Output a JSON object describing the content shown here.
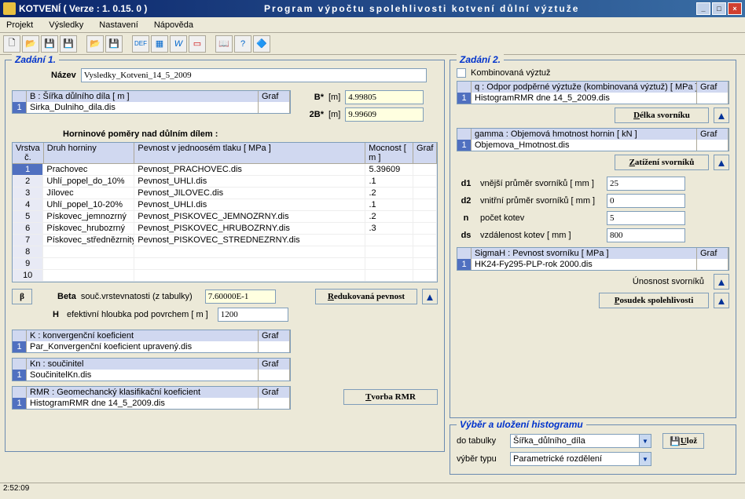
{
  "title_left": "KOTVENÍ ( Verze : 1. 0.15. 0 )",
  "title_center": "Program výpočtu spolehlivosti kotvení důlní výztuže",
  "menu": [
    "Projekt",
    "Výsledky",
    "Nastavení",
    "Nápověda"
  ],
  "z1_legend": "Zadání 1.",
  "z2_legend": "Zadání 2.",
  "hist_legend": "Výběr a uložení histogramu",
  "nazev_label": "Název",
  "nazev_value": "Vysledky_Kotveni_14_5_2009",
  "b_header": "B : Šířka důlního díla   [ m ]",
  "graf": "Graf",
  "b_file": "Sirka_Dulniho_dila.dis",
  "bstar_label": "B*",
  "b2star_label": "2B*",
  "m_unit": "[m]",
  "bstar_val": "4.99805",
  "b2star_val": "9.99609",
  "horn_title": "Horninové poměry nad důlním dílem :",
  "grid": {
    "h1": "Vrstva č.",
    "h2": "Druh horniny",
    "h3": "Pevnost v jednoosém tlaku   [ MPa ]",
    "h4": "Mocnost [ m ]",
    "h5": "Graf",
    "rows": [
      {
        "n": "1",
        "druh": "Prachovec",
        "pev": "Pevnost_PRACHOVEC.dis",
        "moc": "5.39609"
      },
      {
        "n": "2",
        "druh": "Uhlí_popel_do_10%",
        "pev": "Pevnost_UHLI.dis",
        "moc": ".1"
      },
      {
        "n": "3",
        "druh": "Jílovec",
        "pev": "Pevnost_JILOVEC.dis",
        "moc": ".2"
      },
      {
        "n": "4",
        "druh": "Uhlí_popel_10-20%",
        "pev": "Pevnost_UHLI.dis",
        "moc": ".1"
      },
      {
        "n": "5",
        "druh": "Pískovec_jemnozrný",
        "pev": "Pevnost_PISKOVEC_JEMNOZRNY.dis",
        "moc": ".2"
      },
      {
        "n": "6",
        "druh": "Pískovec_hrubozrný",
        "pev": "Pevnost_PISKOVEC_HRUBOZRNY.dis",
        "moc": ".3"
      },
      {
        "n": "7",
        "druh": "Pískovec_střednězrnitý",
        "pev": "Pevnost_PISKOVEC_STREDNEZRNY.dis",
        "moc": ""
      },
      {
        "n": "8",
        "druh": "",
        "pev": "",
        "moc": ""
      },
      {
        "n": "9",
        "druh": "",
        "pev": "",
        "moc": ""
      },
      {
        "n": "10",
        "druh": "",
        "pev": "",
        "moc": ""
      }
    ]
  },
  "beta_btn": "β",
  "beta_label": "Beta",
  "beta_desc": "souč.vrstevnatosti (z tabulky)",
  "beta_val": "7.60000E-1",
  "redpev_label": "Redukovaná pevnost",
  "h_label": "H",
  "h_desc": "efektivní hloubka pod povrchem  [ m ]",
  "h_val": "1200",
  "k_header": "K : konvergenční koeficient",
  "k_file": "Par_Konvergenční koeficient upravený.dis",
  "kn_header": "Kn : součinitel",
  "kn_file": "SoučinitelKn.dis",
  "rmr_header": "RMR : Geomechancký klasifikační koeficient",
  "rmr_file": "HistogramRMR dne 14_5_2009.dis",
  "tvorba_rmr": "Tvorba  RMR",
  "komb_label": "Kombinovaná výztuž",
  "q_header": "q : Odpor podpěrné výztuže (kombinovaná výztuž)   [ MPa ]",
  "q_file": "HistogramRMR dne 14_5_2009.dis",
  "delka_sv": "Délka svorníku",
  "gamma_header": "gamma : Objemová hmotnost hornin   [ kN ]",
  "gamma_file": "Objemova_Hmotnost.dis",
  "zat_sv": "Zatížení svorníků",
  "params": {
    "d1": {
      "l": "d1",
      "d": "vnější průměr svorníků [ mm ]",
      "v": "25"
    },
    "d2": {
      "l": "d2",
      "d": "vnitřní průměr svorníků [ mm ]",
      "v": "0"
    },
    "n": {
      "l": "n",
      "d": "počet kotev",
      "v": "5"
    },
    "ds": {
      "l": "ds",
      "d": "vzdálenost kotev [ mm ]",
      "v": "800"
    }
  },
  "sigmah_header": "SigmaH : Pevnost svorníku   [ MPa ]",
  "sigmah_file": "HK24-Fy295-PLP-rok 2000.dis",
  "unos_sv": "Únosnost svorníků",
  "posudek": "Posudek spolehlivosti",
  "hist_tab_label": "do tabulky",
  "hist_tab_val": "Šířka_důlního_díla",
  "uloz": "Ulož",
  "hist_typ_label": "výběr typu",
  "hist_typ_val": "Parametrické rozdělení",
  "status_time": "2:52:09"
}
